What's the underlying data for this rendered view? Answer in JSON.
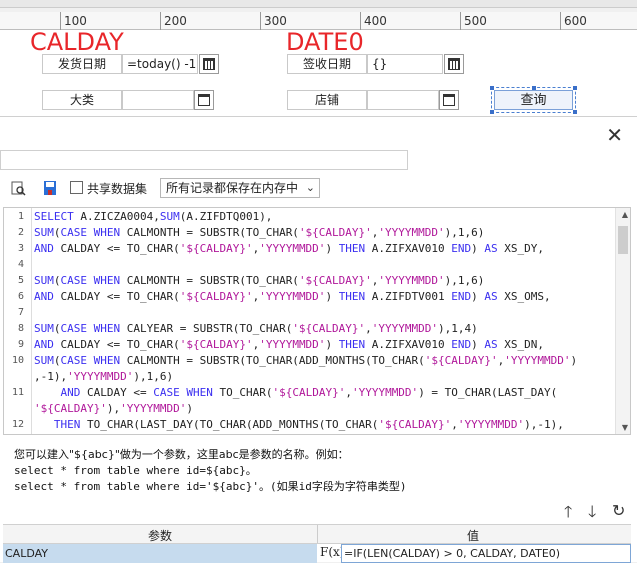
{
  "ruler": {
    "ticks": [
      "100",
      "200",
      "300",
      "400",
      "500",
      "600"
    ]
  },
  "designer": {
    "red_label_1": "CALDAY",
    "red_label_2": "DATE0",
    "ship_date_label": "发货日期",
    "ship_date_value": "=today() -1",
    "receive_date_label": "签收日期",
    "receive_date_value": "{}",
    "category_label": "大类",
    "store_label": "店铺",
    "query_button": "查询"
  },
  "dialog": {
    "close": "✕",
    "share_dataset_label": "共享数据集",
    "save_mode_value": "所有记录都保存在内存中",
    "help_line1": "您可以建入\"${abc}\"做为一个参数，这里abc是参数的名称。例如：",
    "help_line2": "select * from table where id=${abc}。",
    "help_line3": "select * from table where id='${abc}'。(如果id字段为字符串类型)",
    "grid_header_param": "参数",
    "grid_header_value": "值",
    "param_name": "CALDAY",
    "fx_label": "F(x)",
    "param_value": "=IF(LEN(CALDAY) > 0, CALDAY, DATE0)"
  },
  "sql_lines": [
    {
      "n": "1",
      "t": "SELECT A.ZICZA0004,SUM(A.ZIFDTQ001),"
    },
    {
      "n": "2",
      "t": "SUM(CASE WHEN CALMONTH = SUBSTR(TO_CHAR('${CALDAY}','YYYYMMDD'),1,6)"
    },
    {
      "n": "3",
      "t": "AND CALDAY <= TO_CHAR('${CALDAY}','YYYYMMDD') THEN A.ZIFXAV010 END) AS XS_DY,"
    },
    {
      "n": "4",
      "t": ""
    },
    {
      "n": "5",
      "t": "SUM(CASE WHEN CALMONTH = SUBSTR(TO_CHAR('${CALDAY}','YYYYMMDD'),1,6)"
    },
    {
      "n": "6",
      "t": "AND CALDAY <= TO_CHAR('${CALDAY}','YYYYMMDD') THEN A.ZIFDTV001 END) AS XS_OMS,"
    },
    {
      "n": "7",
      "t": ""
    },
    {
      "n": "8",
      "t": "SUM(CASE WHEN CALYEAR = SUBSTR(TO_CHAR('${CALDAY}','YYYYMMDD'),1,4)"
    },
    {
      "n": "9",
      "t": "AND CALDAY <= TO_CHAR('${CALDAY}','YYYYMMDD') THEN A.ZIFXAV010 END) AS XS_DN,"
    },
    {
      "n": "10",
      "t": "SUM(CASE WHEN CALMONTH = SUBSTR(TO_CHAR(ADD_MONTHS(TO_CHAR('${CALDAY}','YYYYMMDD')"
    },
    {
      "n": "",
      "t": ",-1),'YYYYMMDD'),1,6)"
    },
    {
      "n": "11",
      "t": "    AND CALDAY <= CASE WHEN TO_CHAR('${CALDAY}','YYYYMMDD') = TO_CHAR(LAST_DAY("
    },
    {
      "n": "",
      "t": "'${CALDAY}'),'YYYYMMDD')"
    },
    {
      "n": "12",
      "t": "   THEN TO_CHAR(LAST_DAY(TO_CHAR(ADD_MONTHS(TO_CHAR('${CALDAY}','YYYYMMDD'),-1),"
    }
  ]
}
